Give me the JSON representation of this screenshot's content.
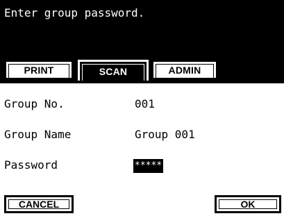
{
  "header": {
    "prompt": "Enter group password."
  },
  "tabs": [
    {
      "label": "PRINT",
      "active": false
    },
    {
      "label": "SCAN",
      "active": true
    },
    {
      "label": "ADMIN",
      "active": false
    }
  ],
  "fields": {
    "group_no": {
      "label": "Group No.",
      "value": "001"
    },
    "group_name": {
      "label": "Group Name",
      "value": "Group 001"
    },
    "password": {
      "label": "Password",
      "value": "*****"
    }
  },
  "buttons": {
    "cancel": "CANCEL",
    "ok": "OK"
  },
  "colors": {
    "background": "#ffffff",
    "header": "#000000",
    "text": "#000000"
  }
}
